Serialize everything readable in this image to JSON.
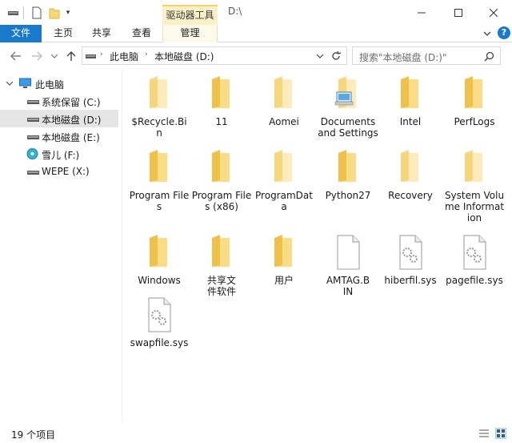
{
  "window": {
    "title": "D:\\",
    "context_tab": "驱动器工具"
  },
  "ribbon": {
    "tabs": [
      "文件",
      "主页",
      "共享",
      "查看",
      "管理"
    ],
    "help": "?"
  },
  "address": {
    "crumbs": [
      "此电脑",
      "本地磁盘 (D:)"
    ]
  },
  "search": {
    "placeholder": "搜索\"本地磁盘 (D:)\""
  },
  "nav_tree": [
    {
      "label": "此电脑",
      "icon": "pc-icon"
    },
    {
      "label": "系统保留 (C:)",
      "icon": "drive-icon"
    },
    {
      "label": "本地磁盘 (D:)",
      "icon": "drive-icon",
      "selected": true
    },
    {
      "label": "本地磁盘 (E:)",
      "icon": "drive-icon"
    },
    {
      "label": "雪儿 (F:)",
      "icon": "cd-drive-icon"
    },
    {
      "label": "WEPE (X:)",
      "icon": "drive-icon"
    }
  ],
  "files": [
    {
      "name": "$Recycle.Bin",
      "icon": "folder-faded-icon"
    },
    {
      "name": "11",
      "icon": "folder-icon"
    },
    {
      "name": "Aomei",
      "icon": "folder-faded-icon"
    },
    {
      "name": "Documents and Settings",
      "icon": "folder-shortcut-icon"
    },
    {
      "name": "Intel",
      "icon": "folder-icon"
    },
    {
      "name": "PerfLogs",
      "icon": "folder-icon"
    },
    {
      "name": "Program Files",
      "icon": "folder-icon"
    },
    {
      "name": "Program Files (x86)",
      "icon": "folder-icon"
    },
    {
      "name": "ProgramData",
      "icon": "folder-faded-icon"
    },
    {
      "name": "Python27",
      "icon": "folder-icon"
    },
    {
      "name": "Recovery",
      "icon": "folder-faded-icon"
    },
    {
      "name": "System Volume Information",
      "icon": "folder-faded-icon"
    },
    {
      "name": "Windows",
      "icon": "folder-icon"
    },
    {
      "name": "共享文件软件",
      "icon": "folder-icon"
    },
    {
      "name": "用户",
      "icon": "folder-icon"
    },
    {
      "name": "AMTAG.BIN",
      "icon": "file-icon"
    },
    {
      "name": "hiberfil.sys",
      "icon": "system-file-icon"
    },
    {
      "name": "pagefile.sys",
      "icon": "system-file-icon"
    },
    {
      "name": "swapfile.sys",
      "icon": "system-file-icon"
    }
  ],
  "status": {
    "item_count": "19 个项目"
  },
  "colors": {
    "accent": "#1979ca",
    "folder": "#f8d775",
    "selection": "#e5e5e5"
  }
}
